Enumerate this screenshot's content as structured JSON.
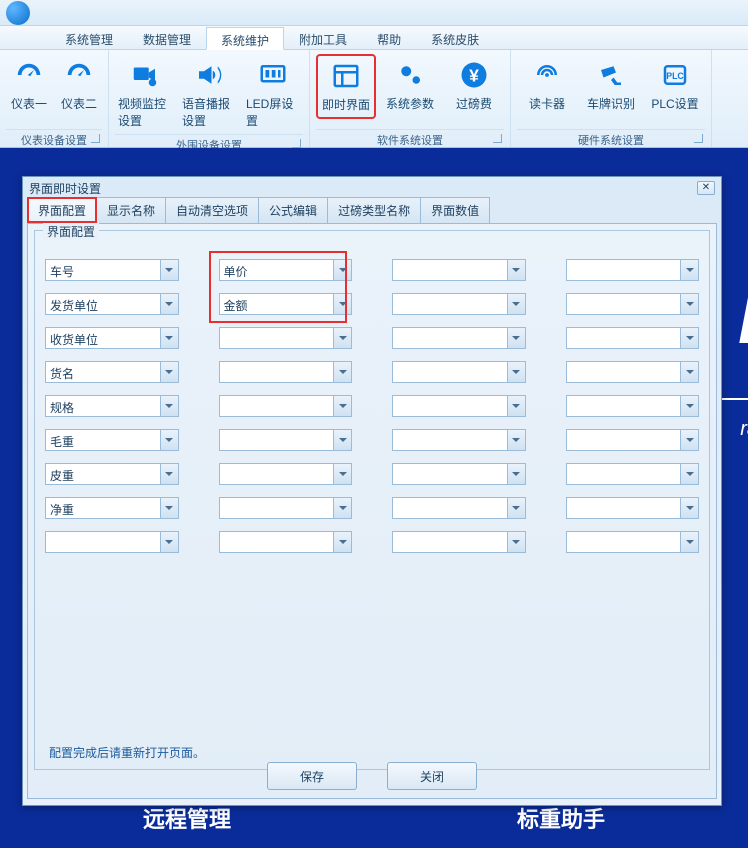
{
  "menubar": {
    "items": [
      {
        "label": "系统管理"
      },
      {
        "label": "数据管理"
      },
      {
        "label": "系统维护",
        "active": true
      },
      {
        "label": "附加工具"
      },
      {
        "label": "帮助"
      },
      {
        "label": "系统皮肤"
      }
    ]
  },
  "ribbon": {
    "groups": [
      {
        "title": "仪表设备设置",
        "buttons": [
          {
            "label": "仪表一",
            "icon": "gauge-icon",
            "small": true
          },
          {
            "label": "仪表二",
            "icon": "gauge-icon",
            "small": true
          }
        ]
      },
      {
        "title": "外围设备设置",
        "buttons": [
          {
            "label": "视频监控设置",
            "icon": "video-gear-icon"
          },
          {
            "label": "语音播报设置",
            "icon": "speaker-icon"
          },
          {
            "label": "LED屏设置",
            "icon": "led-icon"
          }
        ]
      },
      {
        "title": "软件系统设置",
        "buttons": [
          {
            "label": "即时界面",
            "icon": "window-icon",
            "highlight": true
          },
          {
            "label": "系统参数",
            "icon": "gears-icon"
          },
          {
            "label": "过磅费",
            "icon": "yen-icon"
          }
        ]
      },
      {
        "title": "硬件系统设置",
        "buttons": [
          {
            "label": "读卡器",
            "icon": "rfid-icon"
          },
          {
            "label": "车牌识别",
            "icon": "camera-icon"
          },
          {
            "label": "PLC设置",
            "icon": "plc-icon"
          }
        ]
      }
    ]
  },
  "dialog": {
    "title": "界面即时设置",
    "tabs": [
      {
        "label": "界面配置",
        "active": true,
        "highlight": true
      },
      {
        "label": "显示名称"
      },
      {
        "label": "自动清空选项"
      },
      {
        "label": "公式编辑"
      },
      {
        "label": "过磅类型名称"
      },
      {
        "label": "界面数值"
      }
    ],
    "groupbox_title": "界面配置",
    "grid": [
      [
        "车号",
        "单价",
        "",
        ""
      ],
      [
        "发货单位",
        "金额",
        "",
        ""
      ],
      [
        "收货单位",
        "",
        "",
        ""
      ],
      [
        "货名",
        "",
        "",
        ""
      ],
      [
        "规格",
        "",
        "",
        ""
      ],
      [
        "毛重",
        "",
        "",
        ""
      ],
      [
        "皮重",
        "",
        "",
        ""
      ],
      [
        "净重",
        "",
        "",
        ""
      ],
      [
        "",
        "",
        "",
        ""
      ]
    ],
    "hint": "配置完成后请重新打开页面。",
    "save_label": "保存",
    "close_label": "关闭"
  },
  "bg": {
    "bottom1": "远程管理",
    "bottom2": "标重助手"
  }
}
